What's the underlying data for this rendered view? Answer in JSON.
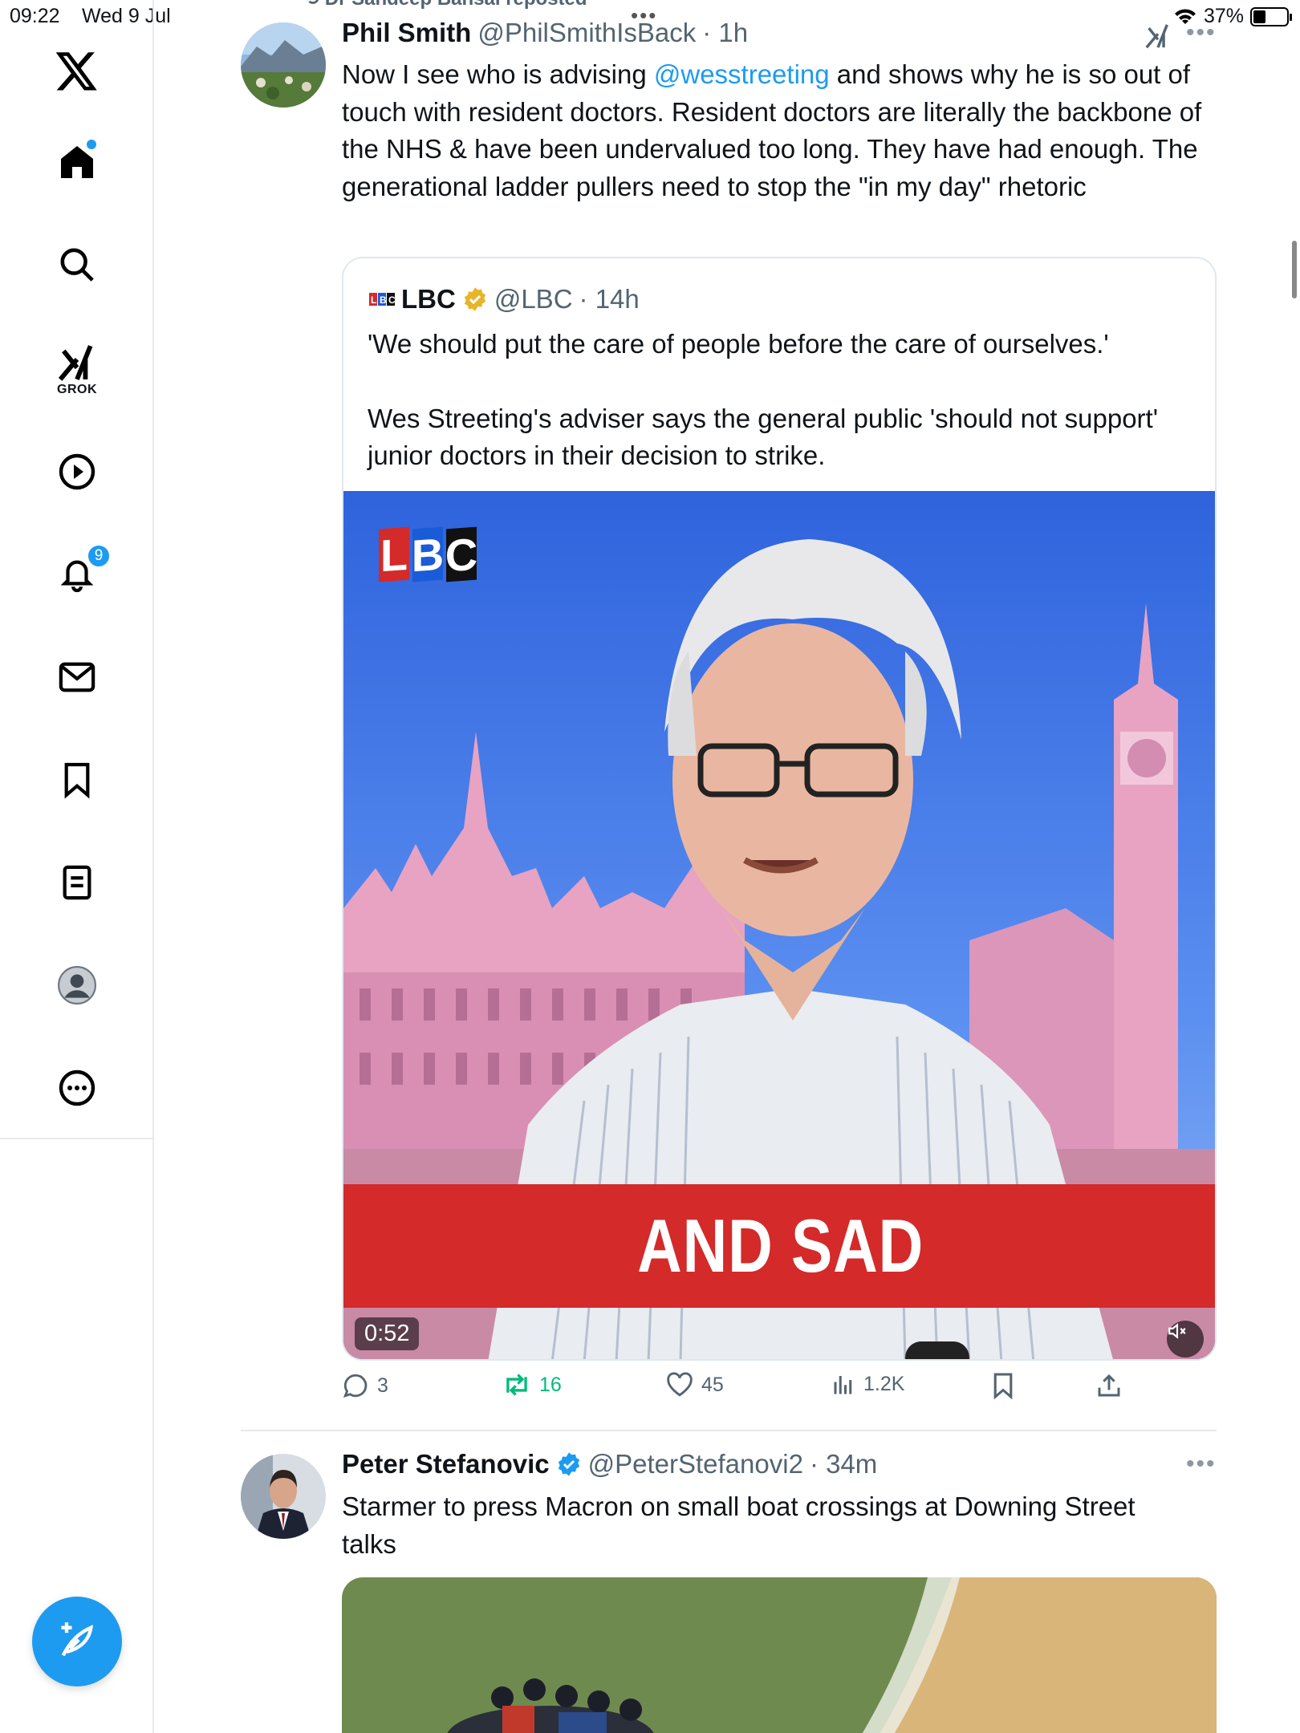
{
  "status_bar": {
    "time": "09:22",
    "date": "Wed 9 Jul",
    "battery_text": "37%",
    "battery_level": 0.37
  },
  "sidebar": {
    "grok_label": "GROK",
    "notifications_count": "9"
  },
  "feed": {
    "repost_banner": "Dr Sandeep Bansal reposted",
    "post1": {
      "name": "Phil Smith",
      "handle": "@PhilSmithIsBack",
      "time": "· 1h",
      "text_before": "Now I see who is advising ",
      "mention": "@wesstreeting",
      "text_after": " and shows why he is so out of touch with resident doctors.  Resident doctors are literally the backbone of the NHS & have been undervalued too long. They have had enough. The generational ladder pullers need to stop the \"in my day\" rhetoric",
      "quote": {
        "name": "LBC",
        "handle": "@LBC",
        "time": "· 14h",
        "line1": "'We should put the care of people before the care of ourselves.'",
        "line2": "Wes Streeting's adviser says the general public 'should not support' junior doctors in their decision to strike.",
        "video": {
          "logo_letters": [
            "L",
            "B",
            "C"
          ],
          "caption": "AND SAD",
          "duration": "0:52"
        }
      },
      "actions": {
        "replies": "3",
        "reposts": "16",
        "likes": "45",
        "views": "1.2K"
      }
    },
    "post2": {
      "name": "Peter Stefanovic",
      "handle": "@PeterStefanovi2",
      "time": "· 34m",
      "text": "Starmer to press Macron on small boat crossings at Downing Street talks"
    }
  },
  "colors": {
    "accent": "#1d9bf0",
    "repost_green": "#00ba7c",
    "banner_red": "#d42a2a",
    "muted_text": "#536471"
  }
}
